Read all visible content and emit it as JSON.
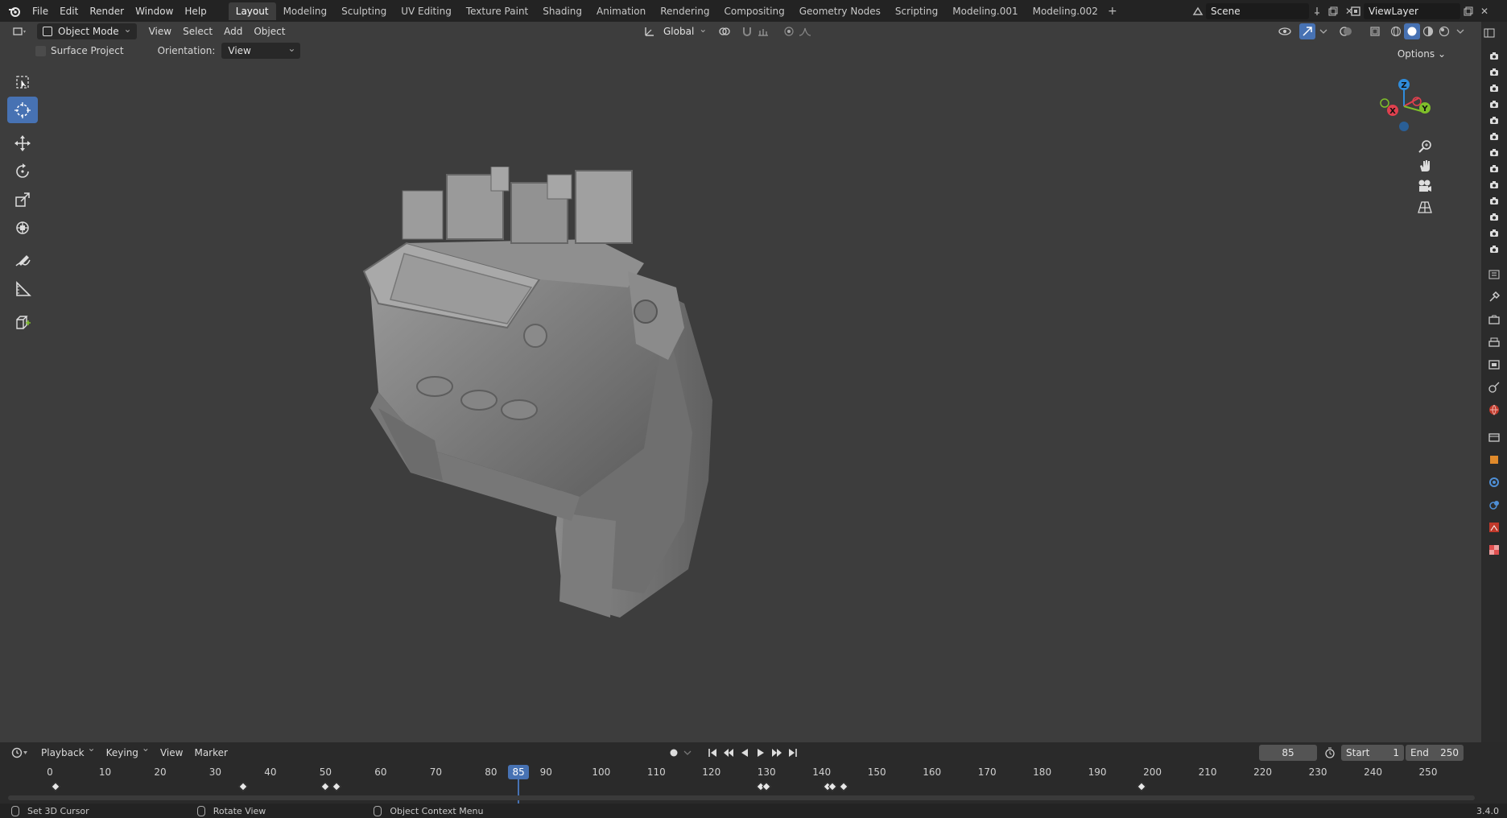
{
  "topbar": {
    "menus": [
      "File",
      "Edit",
      "Render",
      "Window",
      "Help"
    ],
    "workspaces": [
      "Layout",
      "Modeling",
      "Sculpting",
      "UV Editing",
      "Texture Paint",
      "Shading",
      "Animation",
      "Rendering",
      "Compositing",
      "Geometry Nodes",
      "Scripting",
      "Modeling.001",
      "Modeling.002"
    ],
    "active_workspace": "Layout",
    "scene": "Scene",
    "view_layer": "ViewLayer"
  },
  "viewport_header": {
    "mode": "Object Mode",
    "menus": [
      "View",
      "Select",
      "Add",
      "Object"
    ],
    "transform_orientation": "Global",
    "options_label": "Options"
  },
  "subheader": {
    "surface_project_label": "Surface Project",
    "orientation_label": "Orientation:",
    "orientation_value": "View"
  },
  "gizmo": {
    "z": "Z",
    "x": "X",
    "y": "Y"
  },
  "timeline": {
    "menus": [
      "Playback",
      "Keying",
      "View",
      "Marker"
    ],
    "current_frame": "85",
    "start_label": "Start",
    "start_value": "1",
    "end_label": "End",
    "end_value": "250",
    "ticks": [
      0,
      10,
      20,
      30,
      40,
      50,
      60,
      70,
      80,
      90,
      100,
      110,
      120,
      130,
      140,
      150,
      160,
      170,
      180,
      190,
      200,
      210,
      220,
      230,
      240,
      250
    ],
    "playhead": 85,
    "keyframes": [
      1,
      35,
      50,
      52,
      129,
      130,
      141,
      142,
      144,
      198
    ]
  },
  "statusbar": {
    "items": [
      "Set 3D Cursor",
      "Rotate View",
      "Object Context Menu"
    ],
    "version": "3.4.0"
  },
  "colors": {
    "accent": "#4772b3",
    "viewport_bg": "#3d3d3d",
    "axis_x": "#e0404e",
    "axis_y": "#7fbf2a",
    "axis_z": "#2f8cdb"
  }
}
